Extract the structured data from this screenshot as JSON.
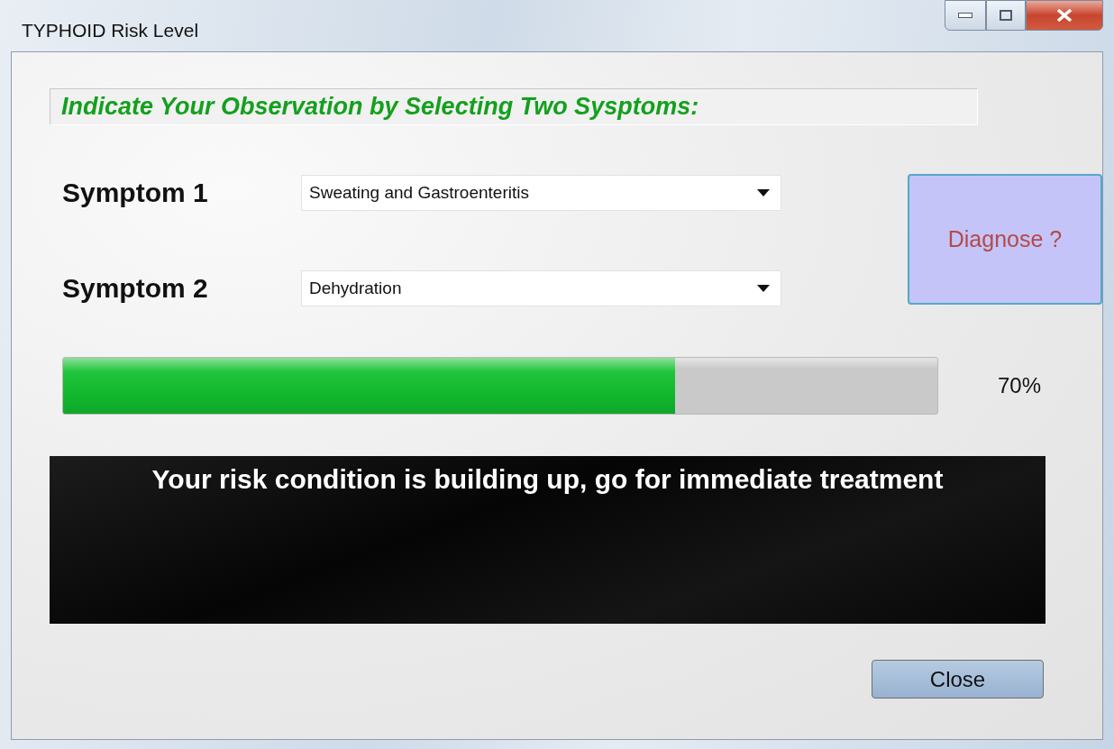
{
  "window": {
    "title": "TYPHOID Risk Level"
  },
  "instruction": "Indicate Your Observation by Selecting Two Sysptoms:",
  "symptoms": [
    {
      "label": "Symptom 1",
      "value": "Sweating and Gastroenteritis"
    },
    {
      "label": "Symptom 2",
      "value": "Dehydration"
    }
  ],
  "diagnose_button": "Diagnose ?",
  "risk_meter": {
    "level": 0.7,
    "reading": "70%"
  },
  "message": "Your risk condition is building up, go for immediate treatment",
  "buttons": [
    "Close"
  ]
}
